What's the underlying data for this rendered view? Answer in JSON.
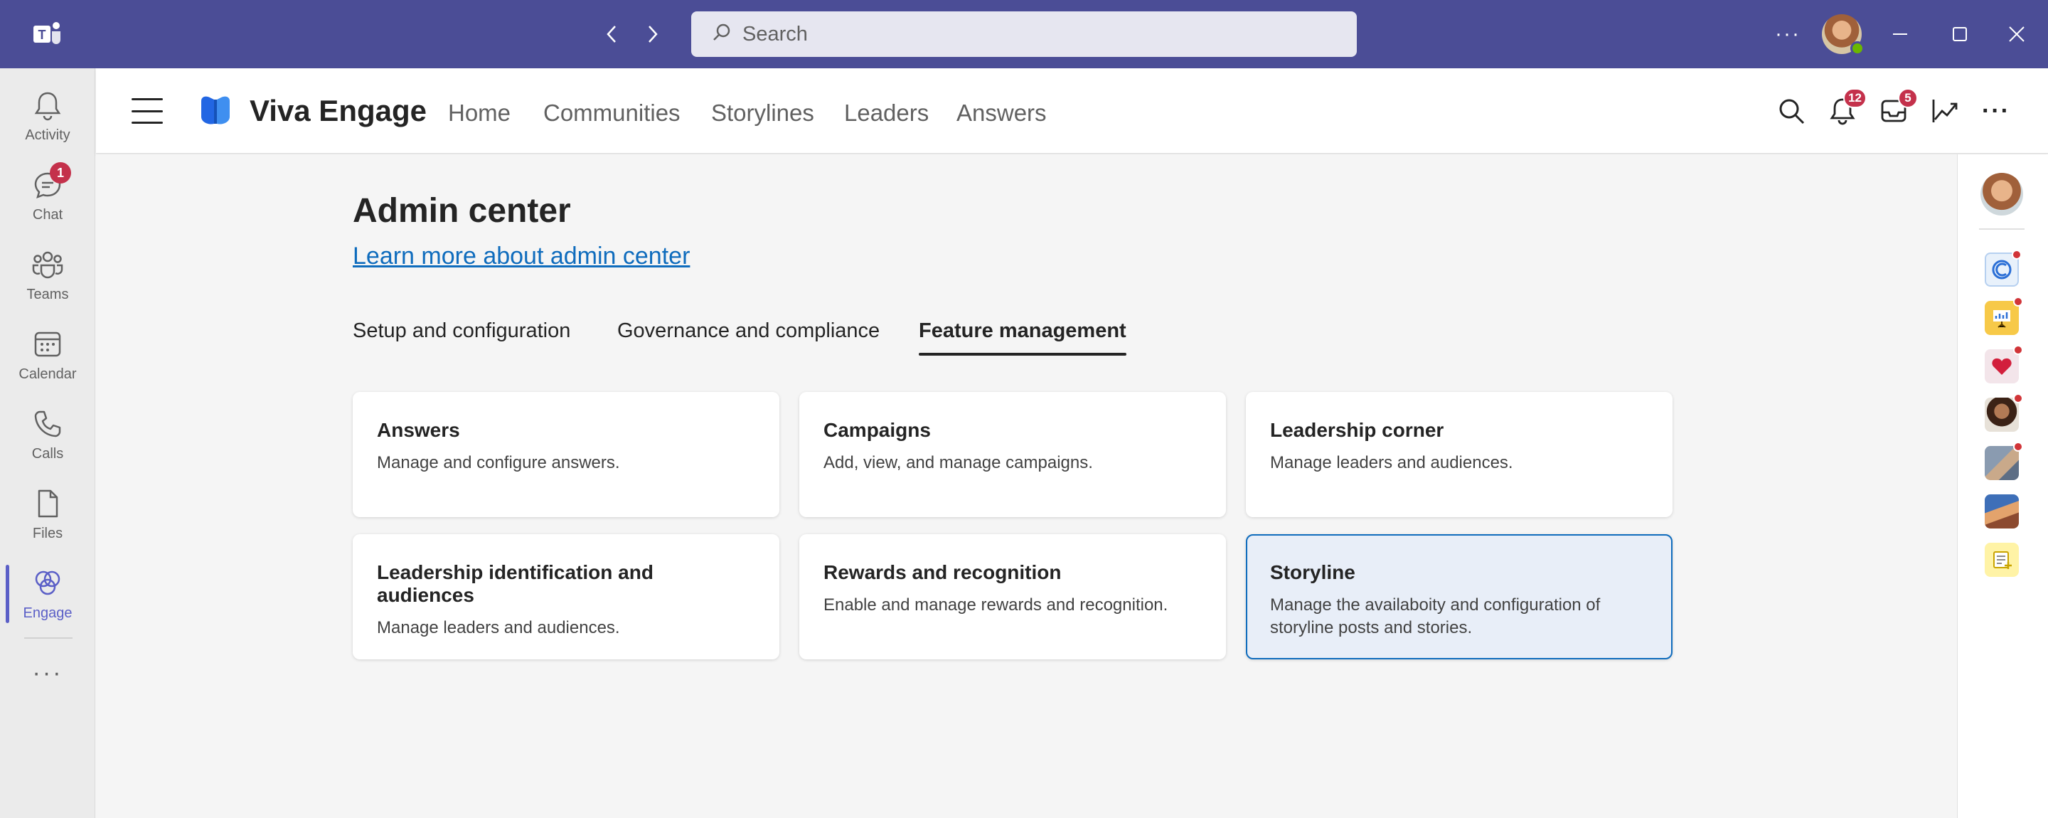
{
  "titlebar": {
    "search_placeholder": "Search"
  },
  "left_rail": {
    "items": [
      {
        "label": "Activity",
        "icon": "bell-icon"
      },
      {
        "label": "Chat",
        "icon": "chat-icon",
        "badge": "1"
      },
      {
        "label": "Teams",
        "icon": "teams-icon"
      },
      {
        "label": "Calendar",
        "icon": "calendar-icon"
      },
      {
        "label": "Calls",
        "icon": "phone-icon"
      },
      {
        "label": "Files",
        "icon": "file-icon"
      },
      {
        "label": "Engage",
        "icon": "engage-icon",
        "active": true
      }
    ]
  },
  "header": {
    "app_title": "Viva Engage",
    "nav": [
      "Home",
      "Communities",
      "Storylines",
      "Leaders",
      "Answers"
    ],
    "notifications_badge": "12",
    "inbox_badge": "5"
  },
  "main": {
    "title": "Admin center",
    "learn_more": "Learn more about admin center",
    "tabs": [
      {
        "label": "Setup and configuration",
        "active": false
      },
      {
        "label": "Governance and compliance",
        "active": false
      },
      {
        "label": "Feature management",
        "active": true
      }
    ],
    "cards": [
      {
        "title": "Answers",
        "desc": "Manage and configure answers."
      },
      {
        "title": "Campaigns",
        "desc": "Add, view, and manage campaigns."
      },
      {
        "title": "Leadership corner",
        "desc": "Manage leaders and audiences."
      },
      {
        "title": "Leadership identification and audiences",
        "desc": "Manage leaders and audiences."
      },
      {
        "title": "Rewards and recognition",
        "desc": "Enable and manage rewards and recognition."
      },
      {
        "title": "Storyline",
        "desc": "Manage the availaboity and configuration of storyline posts and stories.",
        "selected": true
      }
    ]
  },
  "colors": {
    "titlebar": "#4b4d96",
    "accent": "#5b5fc7",
    "link": "#0f6cbd",
    "badge": "#c4314b"
  }
}
